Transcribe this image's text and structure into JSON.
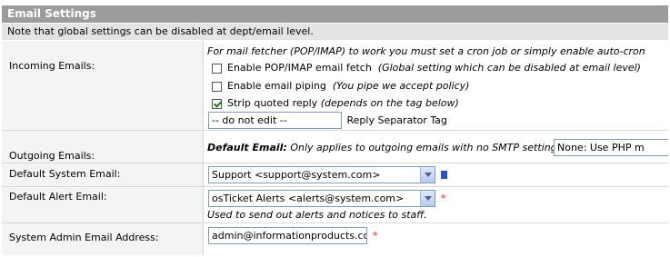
{
  "header": {
    "title": "Email Settings"
  },
  "note": "Note that global settings can be disabled at dept/email level.",
  "incoming": {
    "label": "Incoming Emails:",
    "hint": "For mail fetcher (POP/IMAP) to work you must set a cron job or simply enable auto-cron",
    "pop_label": "Enable POP/IMAP email fetch",
    "pop_note": "(Global setting which can be disabled at email level)",
    "pipe_label": "Enable email piping",
    "pipe_note": "(You pipe we accept policy)",
    "strip_label": "Strip quoted reply",
    "strip_note": "(depends on the tag below)",
    "separator_value": "-- do not edit --",
    "separator_label": "Reply Separator Tag"
  },
  "outgoing": {
    "label": "Outgoing Emails:",
    "default_email_bold": "Default Email:",
    "default_email_note": "Only applies to outgoing emails with no SMTP settings.",
    "smtp_select_value": "None: Use PHP m"
  },
  "default_system_email": {
    "label": "Default System Email:",
    "value": "Support <support@system.com>"
  },
  "default_alert_email": {
    "label": "Default Alert Email:",
    "value": "osTicket Alerts <alerts@system.com>",
    "note": "Used to send out alerts and notices to staff."
  },
  "admin_email": {
    "label": "System Admin Email Address:",
    "value": "admin@informationproducts.com"
  },
  "required_mark": "*",
  "colors": {
    "header_bg": "#9c9c9c",
    "note_bg": "#e4e4e4",
    "label_bg": "#f4f4f4",
    "required": "#e02020"
  }
}
